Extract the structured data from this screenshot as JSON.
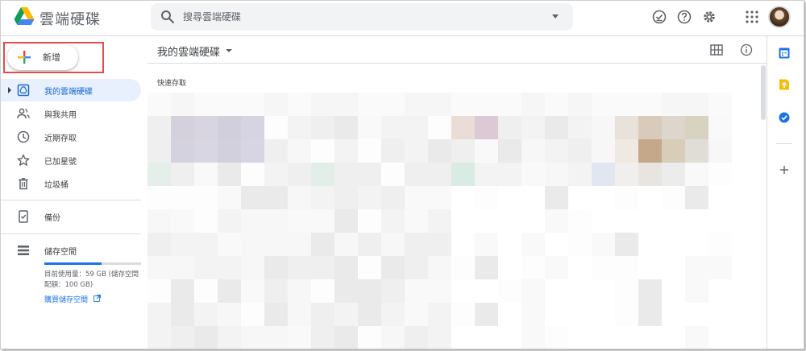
{
  "app": {
    "title": "雲端硬碟"
  },
  "search": {
    "placeholder": "搜尋雲端硬碟"
  },
  "header_icons": [
    "offline-ready-icon",
    "help-icon",
    "settings-icon",
    "apps-grid-icon",
    "avatar"
  ],
  "sidebar": {
    "new_label": "新增",
    "items": [
      {
        "label": "我的雲端硬碟",
        "icon": "drive-icon",
        "active": true
      },
      {
        "label": "與我共用",
        "icon": "people-icon"
      },
      {
        "label": "近期存取",
        "icon": "clock-icon"
      },
      {
        "label": "已加星號",
        "icon": "star-icon"
      },
      {
        "label": "垃圾桶",
        "icon": "trash-icon"
      },
      {
        "label": "備份",
        "icon": "backup-phone-icon"
      },
      {
        "label": "儲存空間",
        "icon": "storage-icon"
      }
    ],
    "storage": {
      "used_fraction": 0.59,
      "usage_text": "目前使用量：59 GB (儲存空間配額：100 GB)",
      "buy_link": "購買儲存空間"
    }
  },
  "main": {
    "title": "我的雲端硬碟",
    "quick_access_label": "快速存取"
  },
  "colors": {
    "accent": "#1a73e8",
    "active_bg": "#e8f0fe",
    "highlight_border": "#e14c4c"
  }
}
